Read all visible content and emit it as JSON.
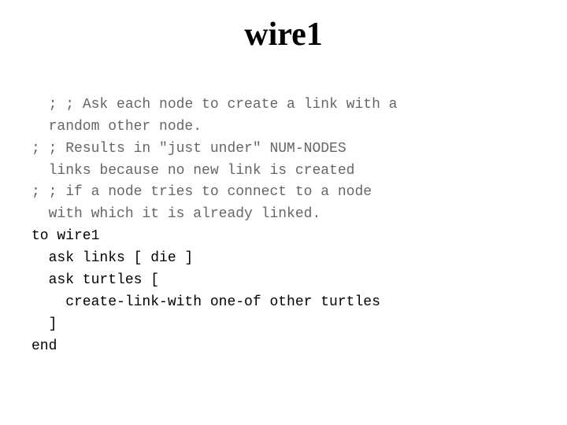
{
  "title": "wire1",
  "code": {
    "line1_comment": "; ; Ask each node to create a link with a",
    "line2_comment": "  random other node.",
    "line3_comment": "; ; Results in \"just under\" NUM-NODES",
    "line4_comment": "  links because no new link is created",
    "line5_comment": "; ; if a node tries to connect to a node",
    "line6_comment": "  with which it is already linked.",
    "line7": "to wire1",
    "line8": "  ask links [ die ]",
    "line9": "  ask turtles [",
    "line10": "    create-link-with one-of other turtles",
    "line11": "  ]",
    "line12": "end"
  }
}
